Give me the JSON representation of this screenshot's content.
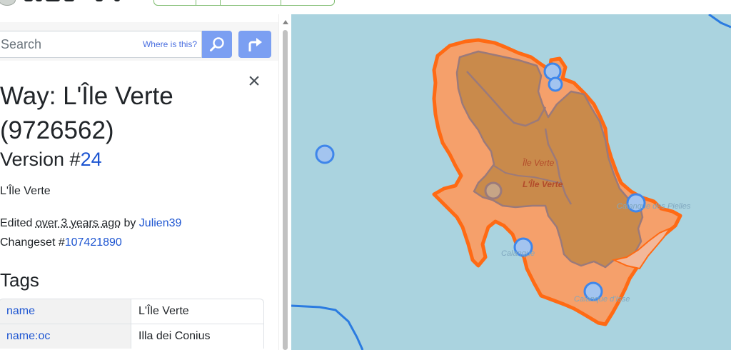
{
  "search": {
    "placeholder": "Search",
    "where_link": "Where is this?"
  },
  "icons": {
    "search": "magnifier-icon",
    "directions": "directions-icon",
    "close": "close-icon"
  },
  "feature": {
    "title": "Way: L'Île Verte (9726562)",
    "version_prefix": "Version #",
    "version_number": "24",
    "name": "L'Île Verte",
    "edited_prefix": "Edited ",
    "edited_ago": "over 3 years ago",
    "edited_by": " by ",
    "user": "Julien39",
    "changeset_prefix": "Changeset #",
    "changeset_id": "107421890"
  },
  "tags": {
    "heading": "Tags",
    "rows": [
      {
        "key": "name",
        "value": "L'Île Verte"
      },
      {
        "key": "name:oc",
        "value": "Illa dei Conius"
      }
    ]
  },
  "map": {
    "labels": [
      "Île Verte",
      "L'Île Verte",
      "Calanque des Pielles",
      "Calanque",
      "Calanque d'Isse"
    ],
    "colors": {
      "water": "#aad3df",
      "island_fill": "#f5a06b",
      "island_outline": "#ff6a14",
      "forest": "#c98a4b",
      "node": "#4a8fe8",
      "road": "#2b7be0"
    }
  }
}
